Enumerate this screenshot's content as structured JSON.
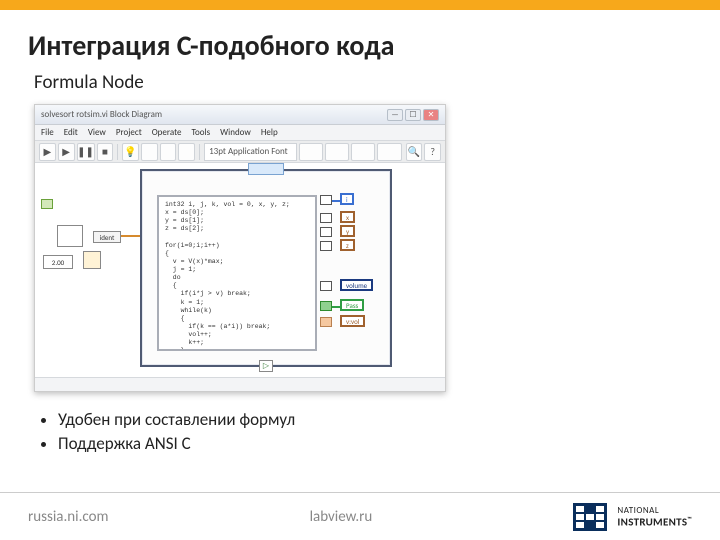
{
  "slide": {
    "title": "Интеграция С-подобного кода",
    "subtitle": "Formula Node",
    "bullets": [
      "Удобен при составлении формул",
      "Поддержка ANSI C"
    ]
  },
  "footer": {
    "left": "russia.ni.com",
    "center": "labview.ru",
    "brand_top": "NATIONAL",
    "brand_bottom": "INSTRUMENTS"
  },
  "window": {
    "title": "solvesort rotsim.vi Block Diagram",
    "menus": [
      "File",
      "Edit",
      "View",
      "Project",
      "Operate",
      "Tools",
      "Window",
      "Help"
    ],
    "font_box": "13pt Application Font"
  },
  "code": "int32 i, j, k, vol = 0, x, y, z;\nx = ds[0];\ny = ds[1];\nz = ds[2];\n\nfor(i=0;i;i++)\n{\n  v = V(x)*max;\n  j = 1;\n  do\n  {\n    if(i*j > v) break;\n    k = 1;\n    while(k)\n    {\n      if(k == (a*i)) break;\n      vol++;\n      k++;\n    }\n  } while(j);\n}",
  "outputs": {
    "i": "i",
    "x": "x",
    "y": "y",
    "z": "z",
    "volume": "volume",
    "pass": "Pass",
    "vol": "v:vol"
  },
  "left_controls": {
    "const": "2.00",
    "ident": "ident"
  },
  "icons": {
    "run": "▶",
    "pause": "❚❚",
    "stop": "■",
    "bulb": "💡",
    "search": "🔍",
    "help": "?",
    "min": "—",
    "max": "☐",
    "close": "✕",
    "play": "▷"
  }
}
